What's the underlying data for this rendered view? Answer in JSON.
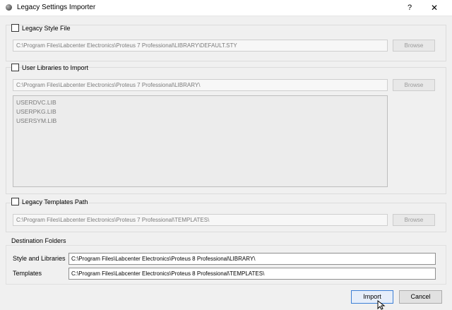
{
  "window": {
    "title": "Legacy Settings Importer",
    "help_label": "?",
    "close_label": "✕"
  },
  "legacy_style": {
    "checkbox_label": "Legacy Style File",
    "checked": false,
    "path": "C:\\Program Files\\Labcenter Electronics\\Proteus 7 Professional\\LIBRARY\\DEFAULT.STY",
    "browse_label": "Browse"
  },
  "user_libraries": {
    "checkbox_label": "User Libraries to Import",
    "checked": false,
    "path": "C:\\Program Files\\Labcenter Electronics\\Proteus 7 Professional\\LIBRARY\\",
    "browse_label": "Browse",
    "items": [
      "USERDVC.LIB",
      "USERPKG.LIB",
      "USERSYM.LIB"
    ]
  },
  "legacy_templates": {
    "checkbox_label": "Legacy Templates Path",
    "checked": false,
    "path": "C:\\Program Files\\Labcenter Electronics\\Proteus 7 Professional\\TEMPLATES\\",
    "browse_label": "Browse"
  },
  "destination": {
    "heading": "Destination Folders",
    "style_label": "Style and Libraries",
    "style_value": "C:\\Program Files\\Labcenter Electronics\\Proteus 8 Professional\\LIBRARY\\",
    "templates_label": "Templates",
    "templates_value": "C:\\Program Files\\Labcenter Electronics\\Proteus 8 Professional\\TEMPLATES\\"
  },
  "footer": {
    "import_label": "Import",
    "cancel_label": "Cancel"
  }
}
